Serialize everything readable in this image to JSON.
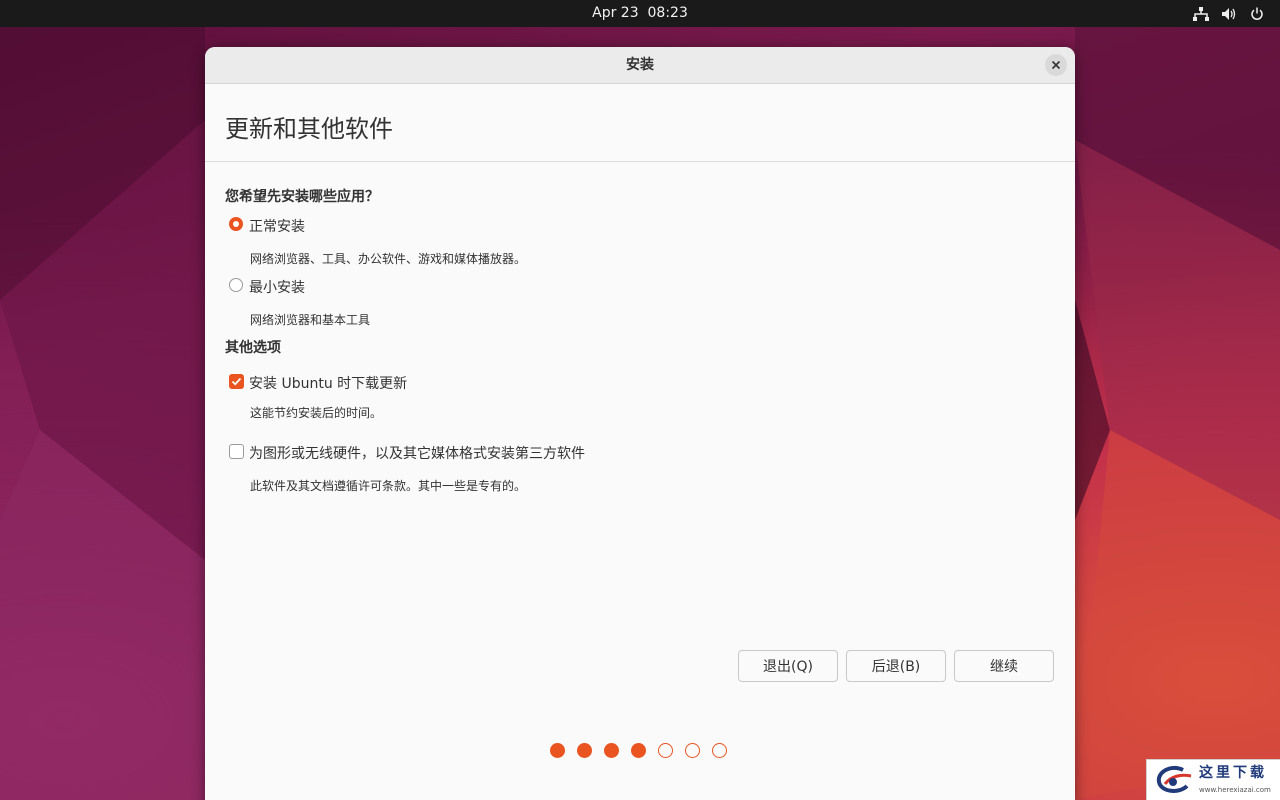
{
  "system_bar": {
    "date": "Apr 23",
    "time": "08:23",
    "tray_icons": [
      "network-icon",
      "volume-icon",
      "power-icon"
    ]
  },
  "window": {
    "title": "安装",
    "page_title": "更新和其他软件",
    "install_question": "您希望先安装哪些应用？",
    "options": [
      {
        "label": "正常安装",
        "description": "网络浏览器、工具、办公软件、游戏和媒体播放器。",
        "selected": true
      },
      {
        "label": "最小安装",
        "description": "网络浏览器和基本工具",
        "selected": false
      }
    ],
    "other_options_title": "其他选项",
    "checks": [
      {
        "label": "安装 Ubuntu 时下载更新",
        "description": "这能节约安装后的时间。",
        "checked": true
      },
      {
        "label": "为图形或无线硬件，以及其它媒体格式安装第三方软件",
        "description": "此软件及其文档遵循许可条款。其中一些是专有的。",
        "checked": false
      }
    ],
    "buttons": {
      "quit": "退出(Q)",
      "back": "后退(B)",
      "continue": "继续"
    },
    "progress": {
      "total_steps": 7,
      "completed_steps": 4
    }
  },
  "watermark": {
    "text": "这里下载",
    "url": "www.herexiazai.com"
  },
  "colors": {
    "accent": "#e95420",
    "topbar": "#1a1a1a",
    "window_bg": "#fafafa"
  }
}
